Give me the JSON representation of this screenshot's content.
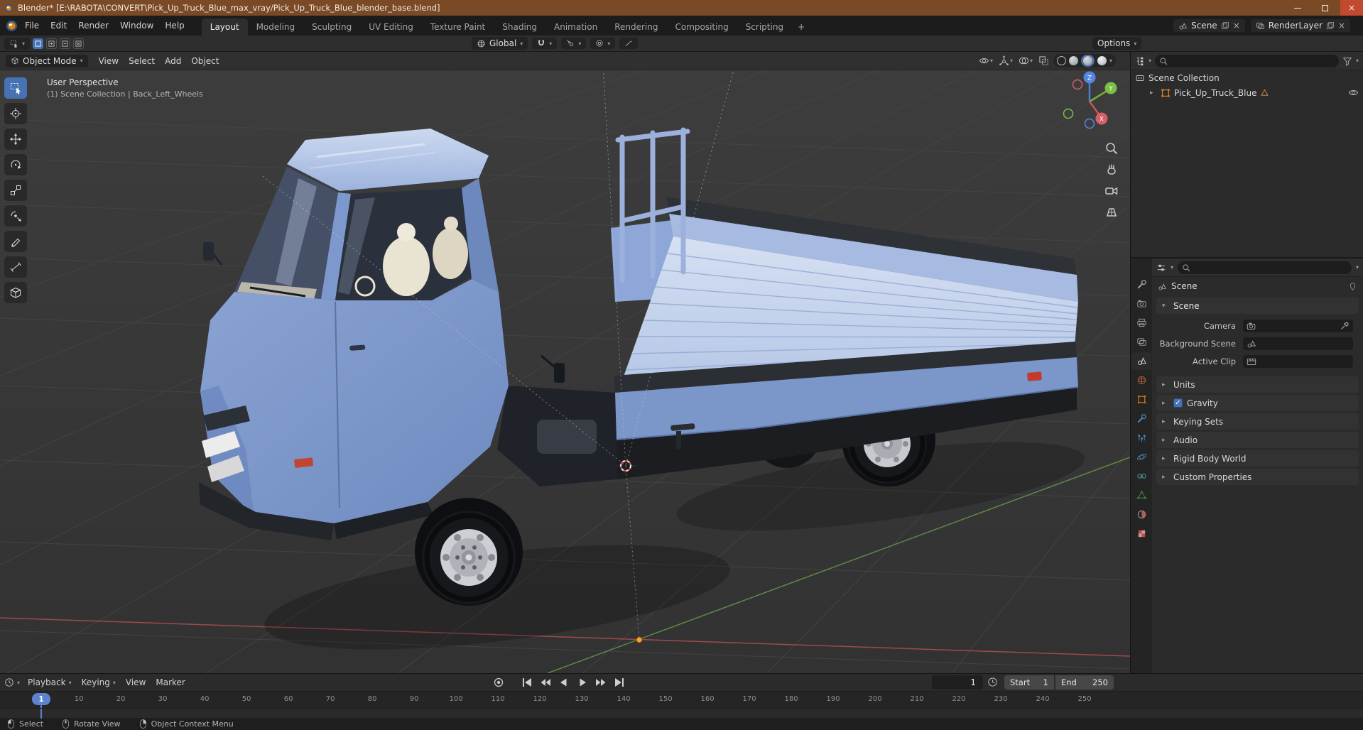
{
  "colors": {
    "accent": "#4772b3",
    "playhead": "#5b84cc",
    "object_orange": "#e8831a",
    "axis_x": "#9e4a4e",
    "axis_y": "#5d8a46",
    "truck_blue": "#7d98cd",
    "titlebar": "#7a4a26",
    "close_button": "#c0492f"
  },
  "window": {
    "title": "Blender* [E:\\RABOTA\\CONVERT\\Pick_Up_Truck_Blue_max_vray/Pick_Up_Truck_Blue_blender_base.blend]",
    "controls": [
      "minimize",
      "maximize",
      "close"
    ]
  },
  "topbar": {
    "menus": [
      "File",
      "Edit",
      "Render",
      "Window",
      "Help"
    ],
    "workspaces": [
      "Layout",
      "Modeling",
      "Sculpting",
      "UV Editing",
      "Texture Paint",
      "Shading",
      "Animation",
      "Rendering",
      "Compositing",
      "Scripting"
    ],
    "active_workspace": "Layout",
    "add_workspace_label": "+",
    "scene": {
      "label": "Scene"
    },
    "view_layer": {
      "label": "RenderLayer"
    }
  },
  "tool_settings": {
    "orientation": "Global",
    "options_label": "Options",
    "icons": [
      "active-tool",
      "select-mode-new",
      "select-mode-extend",
      "select-mode-subtract",
      "select-mode-intersect",
      "transform-orientation",
      "snapping-magnet",
      "snap-target",
      "proportional-editing",
      "proportional-falloff"
    ]
  },
  "viewport": {
    "mode": "Object Mode",
    "header_menus": [
      "View",
      "Select",
      "Add",
      "Object"
    ],
    "overlay_title": "User Perspective",
    "overlay_subtitle": "(1) Scene Collection | Back_Left_Wheels",
    "gizmo_axes": [
      "X",
      "Y",
      "Z"
    ],
    "header_icons": [
      "object-type-visibility",
      "gizmos",
      "overlays",
      "toggle-xray",
      "shading-wireframe",
      "shading-solid",
      "shading-material-preview",
      "shading-rendered"
    ],
    "toolbar_tools": [
      "select-box",
      "cursor",
      "move",
      "rotate",
      "scale",
      "transform",
      "annotate",
      "measure",
      "add-cube"
    ],
    "nav_buttons": [
      "zoom",
      "pan-hand",
      "camera-view",
      "toggle-ortho"
    ]
  },
  "outliner": {
    "rows": [
      {
        "label": "Scene Collection",
        "icon": "collection-icon",
        "depth": 0
      },
      {
        "label": "Pick_Up_Truck_Blue",
        "icon": "collection-instance-icon",
        "badge": "mesh-data-icon",
        "visible": true,
        "depth": 1
      }
    ]
  },
  "properties": {
    "tabs": [
      "tool",
      "render",
      "output",
      "view-layer",
      "scene",
      "world",
      "object",
      "modifiers",
      "particles",
      "physics",
      "constraints",
      "object-data",
      "material",
      "texture"
    ],
    "active_tab": "scene",
    "breadcrumb": "Scene",
    "section_title": "Scene",
    "fields": [
      {
        "label": "Camera",
        "icon": "camera-icon",
        "eyedropper": true
      },
      {
        "label": "Background Scene",
        "icon": "scene-icon"
      },
      {
        "label": "Active Clip",
        "icon": "clip-icon"
      }
    ],
    "collapsed_sections": [
      {
        "label": "Units"
      },
      {
        "label": "Gravity",
        "checked": true
      },
      {
        "label": "Keying Sets"
      },
      {
        "label": "Audio"
      },
      {
        "label": "Rigid Body World"
      },
      {
        "label": "Custom Properties"
      }
    ]
  },
  "timeline": {
    "menus": [
      {
        "label": "Playback",
        "chevron": true
      },
      {
        "label": "Keying",
        "chevron": true
      },
      {
        "label": "View"
      },
      {
        "label": "Marker"
      }
    ],
    "transport": [
      "auto-keying",
      "jump-to-start",
      "jump-to-prev-keyframe",
      "play-reverse",
      "play",
      "jump-to-next-keyframe",
      "jump-to-end"
    ],
    "current_frame": "1",
    "start_label": "Start",
    "start_value": "1",
    "end_label": "End",
    "end_value": "250",
    "ruler": [
      10,
      20,
      30,
      40,
      50,
      60,
      70,
      80,
      90,
      100,
      110,
      120,
      130,
      140,
      150,
      160,
      170,
      180,
      190,
      200,
      210,
      220,
      230,
      240,
      250
    ]
  },
  "statusbar": {
    "hints": [
      {
        "button": "left",
        "label": "Select"
      },
      {
        "button": "middle",
        "label": "Rotate View"
      },
      {
        "button": "right",
        "label": "Object Context Menu"
      }
    ]
  }
}
